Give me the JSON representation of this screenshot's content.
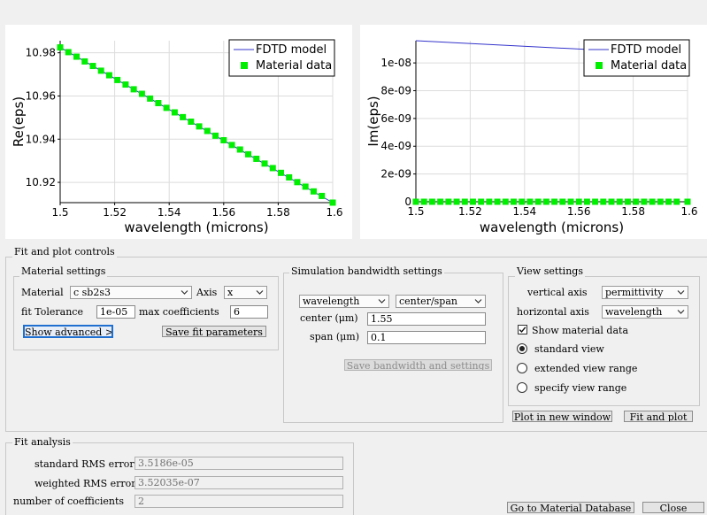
{
  "plots": {
    "re": {
      "ylabel": "Re(eps)",
      "xlabel": "wavelength (microns)",
      "xticks": [
        "1.5",
        "1.52",
        "1.54",
        "1.56",
        "1.58",
        "1.6"
      ],
      "yticks": [
        "10.98",
        "10.96",
        "10.94",
        "10.92"
      ],
      "legend": [
        "FDTD model",
        "Material data"
      ]
    },
    "im": {
      "ylabel": "Im(eps)",
      "xlabel": "wavelength (microns)",
      "xticks": [
        "1.5",
        "1.52",
        "1.54",
        "1.56",
        "1.58",
        "1.6"
      ],
      "yticks": [
        "1e-08",
        "8e-09",
        "6e-09",
        "4e-09",
        "2e-09",
        "0"
      ],
      "legend": [
        "FDTD model",
        "Material data"
      ]
    }
  },
  "chart_data": [
    {
      "type": "line",
      "xlabel": "wavelength (microns)",
      "ylabel": "Re(eps)",
      "xlim": [
        1.5,
        1.6
      ],
      "ylim": [
        10.9106,
        10.9856
      ],
      "grid": true,
      "legend_position": "top-right",
      "series": [
        {
          "name": "FDTD model",
          "kind": "line",
          "color": "#3333cc",
          "x": [
            1.5,
            1.6
          ],
          "y": [
            10.9825,
            10.9106
          ]
        },
        {
          "name": "Material data",
          "kind": "scatter",
          "color": "#00ee00",
          "x": [
            1.5,
            1.503,
            1.506,
            1.509,
            1.512,
            1.515,
            1.518,
            1.521,
            1.524,
            1.527,
            1.53,
            1.533,
            1.536,
            1.539,
            1.542,
            1.545,
            1.548,
            1.551,
            1.554,
            1.557,
            1.56,
            1.563,
            1.566,
            1.569,
            1.572,
            1.575,
            1.578,
            1.581,
            1.584,
            1.587,
            1.59,
            1.593,
            1.596,
            1.6
          ],
          "y": [
            10.9825,
            10.9803,
            10.9782,
            10.976,
            10.9739,
            10.9717,
            10.9696,
            10.9674,
            10.9653,
            10.9631,
            10.961,
            10.9588,
            10.9567,
            10.9545,
            10.9524,
            10.9502,
            10.9481,
            10.9459,
            10.9438,
            10.9416,
            10.9395,
            10.9373,
            10.9352,
            10.933,
            10.9309,
            10.9287,
            10.9266,
            10.9244,
            10.9223,
            10.9201,
            10.918,
            10.9158,
            10.9137,
            10.9106
          ]
        }
      ]
    },
    {
      "type": "line",
      "xlabel": "wavelength (microns)",
      "ylabel": "Im(eps)",
      "xlim": [
        1.5,
        1.6
      ],
      "ylim": [
        0,
        1.16e-08
      ],
      "grid": true,
      "legend_position": "top-right",
      "series": [
        {
          "name": "FDTD model",
          "kind": "line",
          "color": "#3333cc",
          "x": [
            1.5,
            1.6
          ],
          "y": [
            1.16e-08,
            1.06e-08
          ]
        },
        {
          "name": "Material data",
          "kind": "scatter",
          "color": "#00ee00",
          "x": [
            1.5,
            1.503,
            1.506,
            1.509,
            1.512,
            1.515,
            1.518,
            1.521,
            1.524,
            1.527,
            1.53,
            1.533,
            1.536,
            1.539,
            1.542,
            1.545,
            1.548,
            1.551,
            1.554,
            1.557,
            1.56,
            1.563,
            1.566,
            1.569,
            1.572,
            1.575,
            1.578,
            1.581,
            1.584,
            1.587,
            1.59,
            1.593,
            1.596,
            1.6
          ],
          "y": [
            0,
            0,
            0,
            0,
            0,
            0,
            0,
            0,
            0,
            0,
            0,
            0,
            0,
            0,
            0,
            0,
            0,
            0,
            0,
            0,
            0,
            0,
            0,
            0,
            0,
            0,
            0,
            0,
            0,
            0,
            0,
            0,
            0,
            0
          ]
        }
      ]
    }
  ],
  "controls": {
    "title": "Fit and plot controls",
    "material_settings": {
      "title": "Material settings",
      "material_label": "Material",
      "material_value": "c sb2s3",
      "axis_label": "Axis",
      "axis_value": "x",
      "fit_tolerance_label": "fit Tolerance",
      "fit_tolerance_value": "1e-05",
      "max_coefficients_label": "max coefficients",
      "max_coefficients_value": "6",
      "show_advanced": "Show advanced >>",
      "save_fit": "Save fit parameters"
    },
    "simulation": {
      "title": "Simulation bandwidth settings",
      "mode_value": "wavelength",
      "range_value": "center/span",
      "center_label": "center (μm)",
      "center_value": "1.55",
      "span_label": "span (μm)",
      "span_value": "0.1",
      "save_button": "Save bandwidth and settings"
    },
    "view": {
      "title": "View settings",
      "vertical_label": "vertical axis",
      "vertical_value": "permittivity",
      "horizontal_label": "horizontal axis",
      "horizontal_value": "wavelength",
      "show_material": "Show material data",
      "show_material_checked": true,
      "standard_view": "standard view",
      "extended_view": "extended view range",
      "specify_view": "specify view range",
      "selected_view": "standard view"
    },
    "plot_new_window": "Plot in new window",
    "fit_and_plot": "Fit and plot"
  },
  "analysis": {
    "title": "Fit analysis",
    "std_rms_label": "standard RMS error",
    "std_rms_value": "3.5186e-05",
    "weighted_rms_label": "weighted RMS error",
    "weighted_rms_value": "3.52035e-07",
    "num_coeff_label": "number of coefficients",
    "num_coeff_value": "2"
  },
  "footer": {
    "goto_db": "Go to Material Database",
    "close": "Close"
  },
  "colors": {
    "model_line": "#3333cc",
    "material_marker": "#00ee00",
    "focus_border": "#1e6fd0"
  },
  "icons": {
    "dropdown": "chevron-down-icon",
    "checkbox": "checkbox-checked-icon",
    "radio": "radio-icon"
  }
}
